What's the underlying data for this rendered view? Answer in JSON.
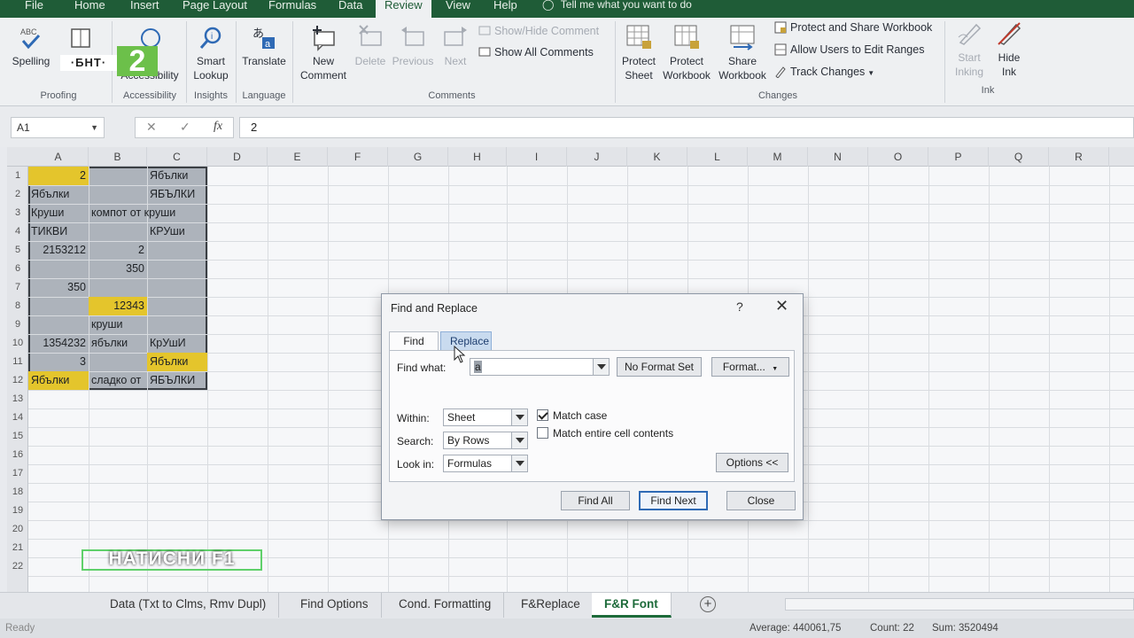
{
  "menu": {
    "tabs": [
      "File",
      "Home",
      "Insert",
      "Page Layout",
      "Formulas",
      "Data",
      "Review",
      "View",
      "Help"
    ],
    "active": "Review",
    "tell_me": "Tell me what you want to do"
  },
  "ribbon": {
    "proofing": {
      "spelling": "Spelling",
      "thesaurus": "T",
      "label": "Proofing"
    },
    "accessibility": {
      "check": "Accessibility",
      "label": "Accessibility"
    },
    "insights": {
      "smart_lookup_1": "Smart",
      "smart_lookup_2": "Lookup",
      "label": "Insights"
    },
    "language": {
      "translate": "Translate",
      "label": "Language"
    },
    "comments": {
      "new_1": "New",
      "new_2": "Comment",
      "delete": "Delete",
      "previous": "Previous",
      "next": "Next",
      "show_hide": "Show/Hide Comment",
      "show_all": "Show All Comments",
      "label": "Comments"
    },
    "changes": {
      "protect_sheet_1": "Protect",
      "protect_sheet_2": "Sheet",
      "protect_workbook_1": "Protect",
      "protect_workbook_2": "Workbook",
      "share_workbook_1": "Share",
      "share_workbook_2": "Workbook",
      "protect_share": "Protect and Share Workbook",
      "allow_users": "Allow Users to Edit Ranges",
      "track_changes": "Track Changes",
      "label": "Changes"
    },
    "ink": {
      "start_1": "Start",
      "start_2": "Inking",
      "hide_1": "Hide",
      "hide_2": "Ink",
      "label": "Ink"
    }
  },
  "tv_logo": {
    "text": "·БНТ·",
    "number": "2"
  },
  "formula_bar": {
    "name_box": "A1",
    "cancel": "✕",
    "enter": "✓",
    "fx": "fx",
    "value": "2"
  },
  "columns": [
    "A",
    "B",
    "C",
    "D",
    "E",
    "F",
    "G",
    "H",
    "I",
    "J",
    "K",
    "L",
    "M",
    "N",
    "O",
    "P",
    "Q",
    "R"
  ],
  "rows": [
    "1",
    "2",
    "3",
    "4",
    "5",
    "6",
    "7",
    "8",
    "9",
    "10",
    "11",
    "12",
    "13",
    "14",
    "15",
    "16",
    "17",
    "18",
    "19",
    "20",
    "21",
    "22"
  ],
  "cells": {
    "A1": "2",
    "C1": "Ябълки",
    "A2": "Ябълки",
    "C2": "ЯБЪЛКИ",
    "A3": "Круши",
    "B3": "компот от круши",
    "A4": "ТИКВИ",
    "C4": "КРУши",
    "A5": "2153212",
    "B5": "2",
    "B6": "350",
    "A7": "350",
    "B8": "12343",
    "B9": "круши",
    "A10": "1354232",
    "B10": "ябълки",
    "C10": "КрУшИ",
    "A11": "3",
    "C11": "Ябълки",
    "A12": "Ябълки",
    "B12": "сладко от",
    "C12": "ЯБЪЛКИ"
  },
  "caption": "НАТИСНИ F1",
  "sheet_tabs": [
    "Data (Txt to Clms, Rmv Dupl)",
    "Find Options",
    "Cond. Formatting",
    "F&Replace",
    "F&R Font"
  ],
  "active_sheet": "F&R Font",
  "status": {
    "ready": "Ready",
    "average": "Average: 440061,75",
    "count": "Count: 22",
    "sum": "Sum: 3520494"
  },
  "dialog": {
    "title": "Find and Replace",
    "help": "?",
    "close": "✕",
    "tabs": {
      "find": "Find",
      "replace": "Replace"
    },
    "find_what_label": "Find what:",
    "find_what_value": "a",
    "no_format": "No Format Set",
    "format_btn": "Format...",
    "within_label": "Within:",
    "within_value": "Sheet",
    "search_label": "Search:",
    "search_value": "By Rows",
    "lookin_label": "Look in:",
    "lookin_value": "Formulas",
    "match_case": "Match case",
    "match_case_checked": true,
    "match_entire": "Match entire cell contents",
    "match_entire_checked": false,
    "options_btn": "Options <<",
    "find_all": "Find All",
    "find_next": "Find Next",
    "close_btn": "Close"
  }
}
